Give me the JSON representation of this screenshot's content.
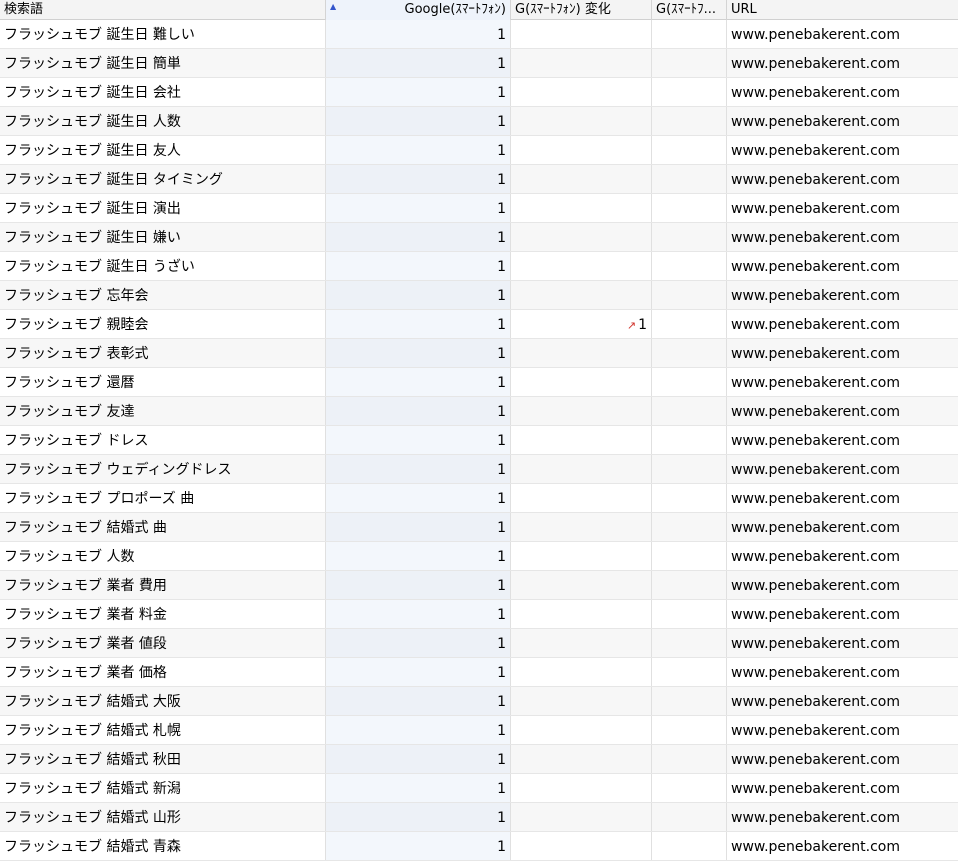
{
  "headers": {
    "term": "検索語",
    "google": "Google(ｽﾏｰﾄﾌｫﾝ)",
    "change": "G(ｽﾏｰﾄﾌｫﾝ) 変化",
    "prev": "G(ｽﾏｰﾄﾌ...",
    "url": "URL"
  },
  "icons": {
    "sort": "sort-ascending-icon",
    "up_arrow": "up-arrow-icon"
  },
  "colors": {
    "up_arrow": "#d0342c",
    "sort_icon": "#3355cc"
  },
  "rows": [
    {
      "term": "フラッシュモブ 誕生日 難しい",
      "rank": "1",
      "change": "",
      "prev": "",
      "url": "www.penebakerent.com"
    },
    {
      "term": "フラッシュモブ 誕生日 簡単",
      "rank": "1",
      "change": "",
      "prev": "",
      "url": "www.penebakerent.com"
    },
    {
      "term": "フラッシュモブ 誕生日 会社",
      "rank": "1",
      "change": "",
      "prev": "",
      "url": "www.penebakerent.com"
    },
    {
      "term": "フラッシュモブ 誕生日 人数",
      "rank": "1",
      "change": "",
      "prev": "",
      "url": "www.penebakerent.com"
    },
    {
      "term": "フラッシュモブ 誕生日 友人",
      "rank": "1",
      "change": "",
      "prev": "",
      "url": "www.penebakerent.com"
    },
    {
      "term": "フラッシュモブ 誕生日 タイミング",
      "rank": "1",
      "change": "",
      "prev": "",
      "url": "www.penebakerent.com"
    },
    {
      "term": "フラッシュモブ 誕生日 演出",
      "rank": "1",
      "change": "",
      "prev": "",
      "url": "www.penebakerent.com"
    },
    {
      "term": "フラッシュモブ 誕生日 嫌い",
      "rank": "1",
      "change": "",
      "prev": "",
      "url": "www.penebakerent.com"
    },
    {
      "term": "フラッシュモブ 誕生日 うざい",
      "rank": "1",
      "change": "",
      "prev": "",
      "url": "www.penebakerent.com"
    },
    {
      "term": "フラッシュモブ 忘年会",
      "rank": "1",
      "change": "",
      "prev": "",
      "url": "www.penebakerent.com"
    },
    {
      "term": "フラッシュモブ 親睦会",
      "rank": "1",
      "change": "1",
      "prev": "",
      "url": "www.penebakerent.com"
    },
    {
      "term": "フラッシュモブ 表彰式",
      "rank": "1",
      "change": "",
      "prev": "",
      "url": "www.penebakerent.com"
    },
    {
      "term": "フラッシュモブ 還暦",
      "rank": "1",
      "change": "",
      "prev": "",
      "url": "www.penebakerent.com"
    },
    {
      "term": "フラッシュモブ 友達",
      "rank": "1",
      "change": "",
      "prev": "",
      "url": "www.penebakerent.com"
    },
    {
      "term": "フラッシュモブ ドレス",
      "rank": "1",
      "change": "",
      "prev": "",
      "url": "www.penebakerent.com"
    },
    {
      "term": "フラッシュモブ ウェディングドレス",
      "rank": "1",
      "change": "",
      "prev": "",
      "url": "www.penebakerent.com"
    },
    {
      "term": "フラッシュモブ プロポーズ 曲",
      "rank": "1",
      "change": "",
      "prev": "",
      "url": "www.penebakerent.com"
    },
    {
      "term": "フラッシュモブ 結婚式 曲",
      "rank": "1",
      "change": "",
      "prev": "",
      "url": "www.penebakerent.com"
    },
    {
      "term": "フラッシュモブ 人数",
      "rank": "1",
      "change": "",
      "prev": "",
      "url": "www.penebakerent.com"
    },
    {
      "term": "フラッシュモブ 業者 費用",
      "rank": "1",
      "change": "",
      "prev": "",
      "url": "www.penebakerent.com"
    },
    {
      "term": "フラッシュモブ 業者 料金",
      "rank": "1",
      "change": "",
      "prev": "",
      "url": "www.penebakerent.com"
    },
    {
      "term": "フラッシュモブ 業者 値段",
      "rank": "1",
      "change": "",
      "prev": "",
      "url": "www.penebakerent.com"
    },
    {
      "term": "フラッシュモブ 業者 価格",
      "rank": "1",
      "change": "",
      "prev": "",
      "url": "www.penebakerent.com"
    },
    {
      "term": "フラッシュモブ 結婚式 大阪",
      "rank": "1",
      "change": "",
      "prev": "",
      "url": "www.penebakerent.com"
    },
    {
      "term": "フラッシュモブ 結婚式 札幌",
      "rank": "1",
      "change": "",
      "prev": "",
      "url": "www.penebakerent.com"
    },
    {
      "term": "フラッシュモブ 結婚式 秋田",
      "rank": "1",
      "change": "",
      "prev": "",
      "url": "www.penebakerent.com"
    },
    {
      "term": "フラッシュモブ 結婚式 新潟",
      "rank": "1",
      "change": "",
      "prev": "",
      "url": "www.penebakerent.com"
    },
    {
      "term": "フラッシュモブ 結婚式 山形",
      "rank": "1",
      "change": "",
      "prev": "",
      "url": "www.penebakerent.com"
    },
    {
      "term": "フラッシュモブ 結婚式 青森",
      "rank": "1",
      "change": "",
      "prev": "",
      "url": "www.penebakerent.com"
    }
  ]
}
